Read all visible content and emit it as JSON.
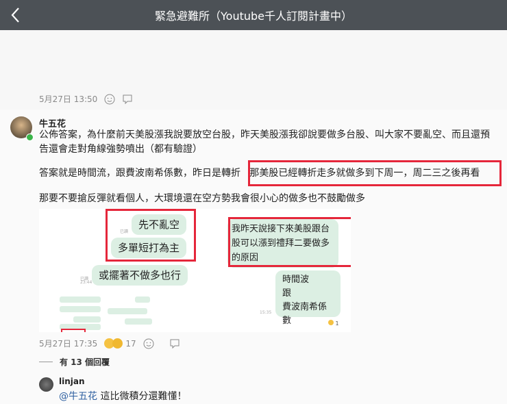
{
  "header": {
    "title": "緊急避難所（Youtube千人訂閱計畫中）"
  },
  "prev": {
    "timestamp": "5月27日 13:50"
  },
  "post": {
    "author": "牛五花",
    "para1": "公佈答案，為什麼前天美股漲我說要放空台股，昨天美股漲我卻說要做多台股、叫大家不要亂空、而且還預告還會走對角線強勢噴出（都有驗證）",
    "para2_prefix": "答案就是時間流，跟費波南希係數，昨日是轉折",
    "para2_highlight": "那美股已經轉折走多就做多到下周一，周二三之後再看",
    "para3": "那要不要搶反彈就看個人，大環境還在空方勢我會很小心的做多也不鼓勵做多",
    "image": {
      "left_bubbles": [
        "先不亂空",
        "多單短打為主",
        "或擺著不做多也行"
      ],
      "read_label": "已讀",
      "time1": "23:44",
      "time2": "15:35",
      "right_bubble_highlight": "我昨天說接下來美股跟台股可以漲到禮拜二要做多的原因",
      "right_bubble_lines": [
        "時間波",
        "跟",
        "費波南希係數"
      ],
      "reaction_count": "1"
    },
    "timestamp": "5月27日 17:35",
    "reaction_count": "17"
  },
  "replies": {
    "label": "有 13 個回覆"
  },
  "reply": {
    "author": "linjan",
    "mention": "@牛五花",
    "text": " 這比微積分還難懂！"
  }
}
